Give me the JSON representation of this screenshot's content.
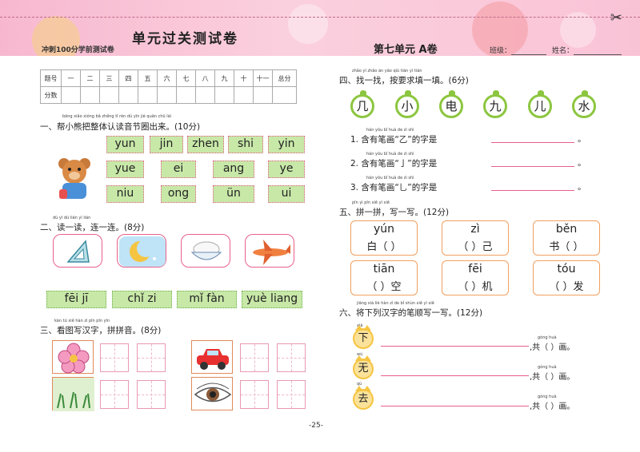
{
  "header": {
    "title": "单元过关测试卷",
    "subtitle": "冲刺100分学前测试卷",
    "unit": "第七单元  A卷",
    "class_label": "班级：",
    "name_label": "姓名："
  },
  "score_table": {
    "row1": [
      "题号",
      "一",
      "二",
      "三",
      "四",
      "五",
      "六",
      "七",
      "八",
      "九",
      "十",
      "十一",
      "总分"
    ],
    "row2_label": "分数"
  },
  "q1": {
    "title": "一、帮小熊把整体认读音节圈出来。(10分)",
    "pinyin": "bāng xiǎo xióng bǎ zhěng tǐ rèn dú yīn jié quān chū lái",
    "syllables": [
      "yun",
      "jin",
      "zhen",
      "shi",
      "yin",
      "yue",
      "ei",
      "ang",
      "ye",
      "niu",
      "ong",
      "ün",
      "ui"
    ]
  },
  "q2": {
    "title": "二、读一读，连一连。(8分)",
    "pinyin": "dú yì dú  lián yì lián",
    "words": [
      "fēi jī",
      "chǐ zi",
      "mǐ fàn",
      "yuè liang"
    ]
  },
  "q3": {
    "title": "三、看图写汉字，拼拼音。(8分)",
    "pinyin": "kàn tú xiě hàn zì  pīn pīn yīn"
  },
  "q4": {
    "title": "四、找一找，按要求填一填。(6分)",
    "pinyin": "zhǎo yì zhǎo  àn yāo qiú tián yì tián",
    "chars": [
      "几",
      "小",
      "电",
      "九",
      "儿",
      "水"
    ],
    "lines": [
      "1. 含有笔画“乙”的字是",
      "2. 含有笔画“亅”的字是",
      "3. 含有笔画“乚”的字是"
    ],
    "line_pinyin": "hán yǒu bǐ huà  de zì shì",
    "period": "。"
  },
  "q5": {
    "title": "五、拼一拼，写一写。(12分)",
    "pinyin": "pīn yì pīn  xiě yì xiě",
    "items": [
      {
        "py": "yún",
        "text": "白（    ）"
      },
      {
        "py": "zì",
        "text": "（    ）己"
      },
      {
        "py": "běn",
        "text": "书（    ）"
      },
      {
        "py": "tiān",
        "text": "（    ）空"
      },
      {
        "py": "fēi",
        "text": "（    ）机"
      },
      {
        "py": "tóu",
        "text": "（    ）发"
      }
    ]
  },
  "q6": {
    "title": "六、将下列汉字的笔顺写一写。(12分)",
    "pinyin": "jiāng xià liè hàn zì de bǐ shùn xiě yì xiě",
    "chars": [
      {
        "py": "xià",
        "ch": "下"
      },
      {
        "py": "wú",
        "ch": "无"
      },
      {
        "py": "qù",
        "ch": "去"
      }
    ],
    "tail": ",共（    ）画。",
    "tail_py": "gòng  huà"
  },
  "page_number": "-25-",
  "colors": {
    "header_pink": "#f7b8cf",
    "green": "#c8e8a8",
    "pink_border": "#e8608a",
    "orange_border": "#f0a060"
  }
}
